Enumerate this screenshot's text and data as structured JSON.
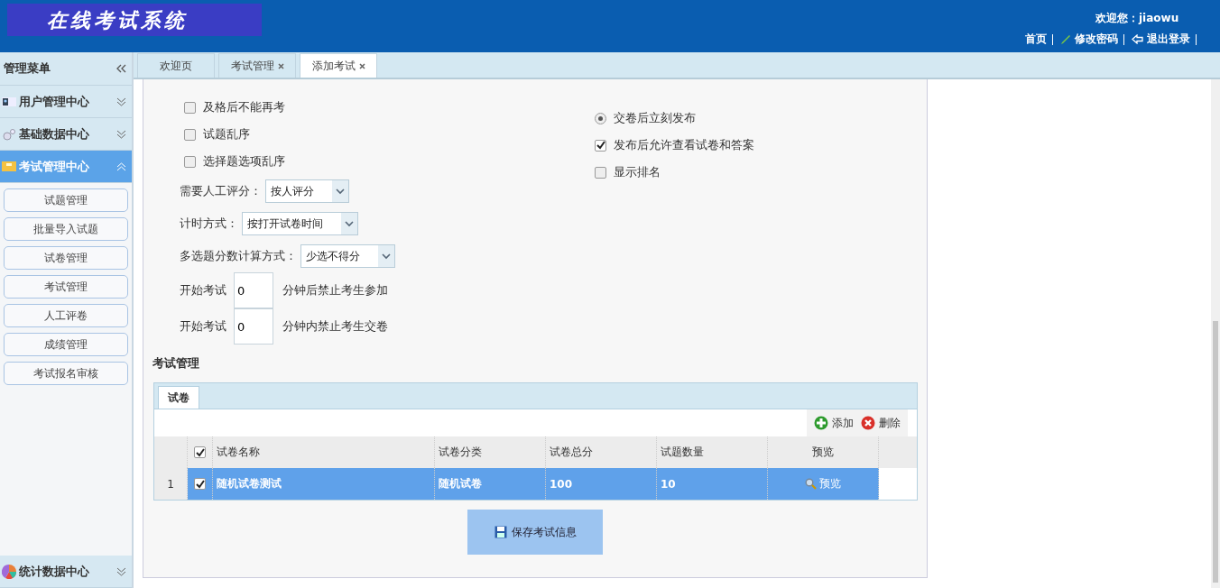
{
  "header": {
    "logo_title": "在线考试系统",
    "welcome": "欢迎您：jiaowu",
    "links": [
      {
        "label": "首页",
        "kind": "plain"
      },
      {
        "label": "修改密码",
        "kind": "pencil"
      },
      {
        "label": "退出登录",
        "kind": "back"
      }
    ]
  },
  "sidebar": {
    "title": "管理菜单",
    "groups": [
      {
        "label": "用户管理中心",
        "expanded": false
      },
      {
        "label": "基础数据中心",
        "expanded": false
      },
      {
        "label": "考试管理中心",
        "expanded": true,
        "items": [
          "试题管理",
          "批量导入试题",
          "试卷管理",
          "考试管理",
          "人工评卷",
          "成绩管理",
          "考试报名审核"
        ]
      },
      {
        "label": "统计数据中心",
        "expanded": false
      }
    ]
  },
  "tabs": [
    {
      "label": "欢迎页",
      "closable": false,
      "selected": false
    },
    {
      "label": "考试管理",
      "closable": true,
      "selected": false
    },
    {
      "label": "添加考试",
      "closable": true,
      "selected": true
    }
  ],
  "form": {
    "options_left": [
      {
        "label": "及格后不能再考",
        "checked": false
      },
      {
        "label": "试题乱序",
        "checked": false
      },
      {
        "label": "选择题选项乱序",
        "checked": false
      }
    ],
    "selects": [
      {
        "label": "需要人工评分：",
        "value": "按人评分"
      },
      {
        "label": "计时方式：",
        "value": "按打开试卷时间"
      },
      {
        "label": "多选题分数计算方式：",
        "value": "少选不得分"
      }
    ],
    "number_fields": [
      {
        "label": "开始考试",
        "value": "0",
        "suffix": "分钟后禁止考生参加"
      },
      {
        "label": "开始考试",
        "value": "0",
        "suffix": "分钟内禁止考生交卷"
      }
    ],
    "options_right": [
      {
        "kind": "radio",
        "label": "交卷后立刻发布",
        "checked": true
      },
      {
        "kind": "checkbox",
        "label": "发布后允许查看试卷和答案",
        "checked": true
      },
      {
        "kind": "checkbox",
        "label": "显示排名",
        "checked": false
      }
    ]
  },
  "section": {
    "title": "考试管理",
    "grid_tab": "试卷",
    "toolbar": [
      {
        "kind": "add",
        "label": "添加"
      },
      {
        "kind": "delete",
        "label": "删除"
      }
    ],
    "header_checked": true,
    "columns": [
      "试卷名称",
      "试卷分类",
      "试卷总分",
      "试题数量",
      "预览"
    ],
    "rows": [
      {
        "index": "1",
        "checked": true,
        "selected": true,
        "cells": [
          "随机试卷测试",
          "随机试卷",
          "100",
          "10"
        ],
        "preview": "预览"
      }
    ]
  },
  "save_button": "保存考试信息"
}
